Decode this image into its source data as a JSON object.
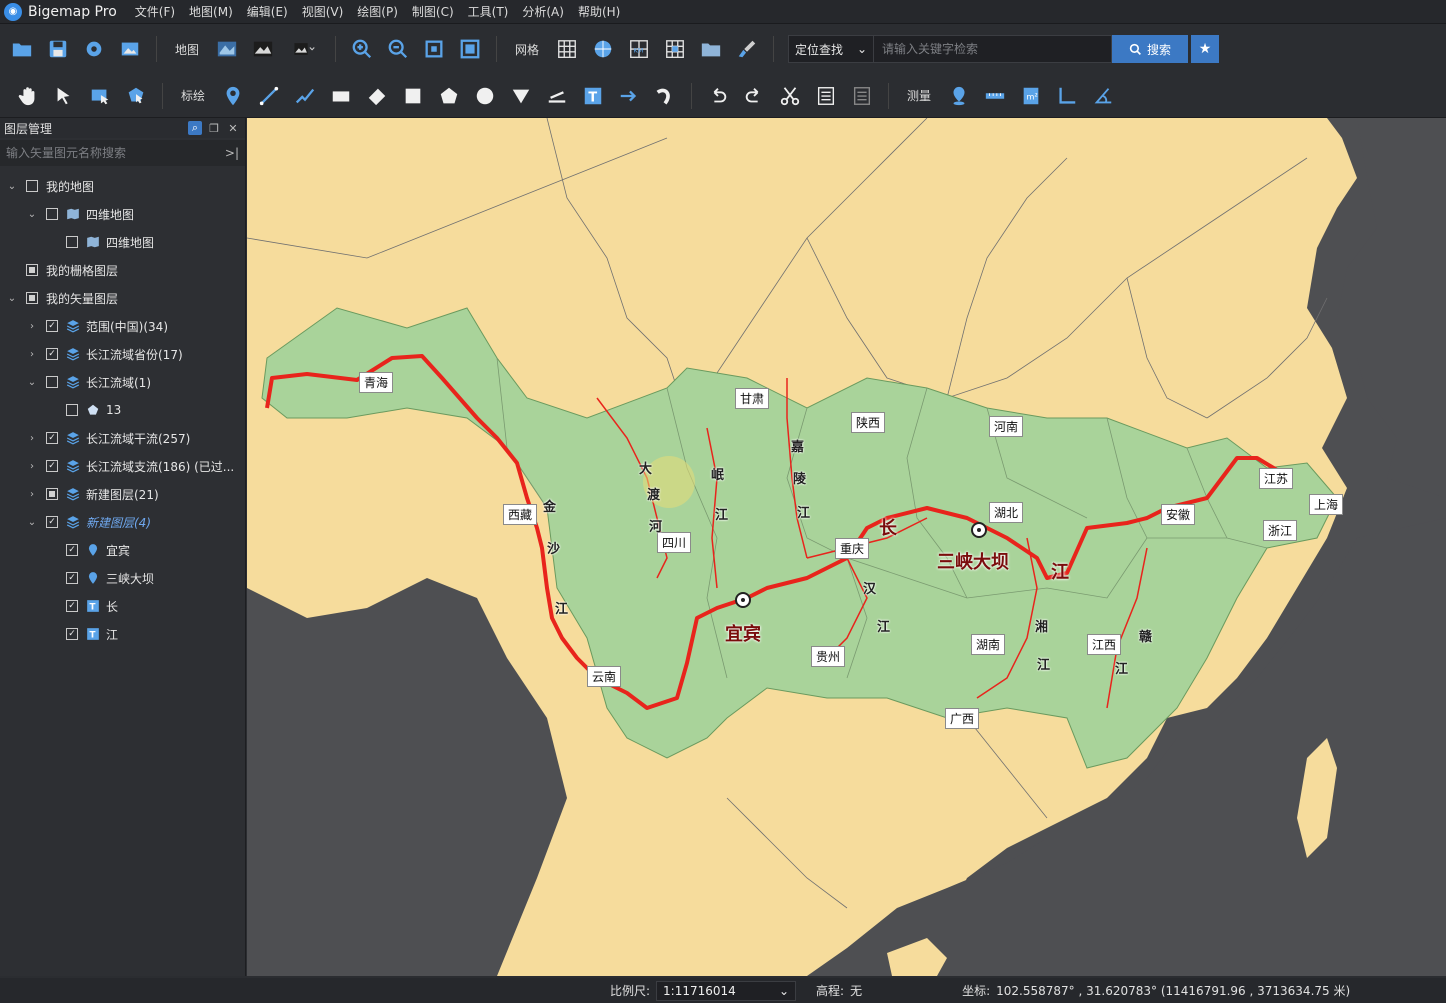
{
  "app": {
    "title": "Bigemap Pro",
    "logo_icon": "globe-logo-icon"
  },
  "menu": [
    "文件(F)",
    "地图(M)",
    "编辑(E)",
    "视图(V)",
    "绘图(P)",
    "制图(C)",
    "工具(T)",
    "分析(A)",
    "帮助(H)"
  ],
  "toolbar1": {
    "map_label": "地图",
    "grid_label": "网格",
    "search_mode": "定位查找",
    "search_placeholder": "请输入关键字检索",
    "search_button": "搜索"
  },
  "toolbar2": {
    "annotate_label": "标绘",
    "measure_label": "测量"
  },
  "sidebar": {
    "title": "图层管理",
    "search_placeholder": "输入矢量图元名称搜索",
    "tree": [
      {
        "label": "我的地图",
        "indent": 0,
        "arrow": "v",
        "check": "none",
        "icon": ""
      },
      {
        "label": "四维地图",
        "indent": 1,
        "arrow": "v",
        "check": "none",
        "icon": "map"
      },
      {
        "label": "四维地图",
        "indent": 2,
        "arrow": "",
        "check": "none",
        "icon": "map"
      },
      {
        "label": "我的栅格图层",
        "indent": 0,
        "arrow": "",
        "check": "partial",
        "icon": ""
      },
      {
        "label": "我的矢量图层",
        "indent": 0,
        "arrow": "v",
        "check": "partial",
        "icon": ""
      },
      {
        "label": "范围(中国)(34)",
        "indent": 1,
        "arrow": ">",
        "check": "checked",
        "icon": "layers"
      },
      {
        "label": "长江流域省份(17)",
        "indent": 1,
        "arrow": ">",
        "check": "checked",
        "icon": "layers"
      },
      {
        "label": "长江流域(1)",
        "indent": 1,
        "arrow": "v",
        "check": "none",
        "icon": "layers"
      },
      {
        "label": "13",
        "indent": 2,
        "arrow": "",
        "check": "none",
        "icon": "polygon"
      },
      {
        "label": "长江流域干流(257)",
        "indent": 1,
        "arrow": ">",
        "check": "checked",
        "icon": "layers"
      },
      {
        "label": "长江流域支流(186) (已过...",
        "indent": 1,
        "arrow": ">",
        "check": "checked",
        "icon": "layers"
      },
      {
        "label": "新建图层(21)",
        "indent": 1,
        "arrow": ">",
        "check": "partial",
        "icon": "layers"
      },
      {
        "label": "新建图层(4)",
        "indent": 1,
        "arrow": "v",
        "check": "checked",
        "icon": "layers",
        "italic": true
      },
      {
        "label": "宜宾",
        "indent": 2,
        "arrow": "",
        "check": "checked",
        "icon": "pin"
      },
      {
        "label": "三峡大坝",
        "indent": 2,
        "arrow": "",
        "check": "checked",
        "icon": "pin"
      },
      {
        "label": "长",
        "indent": 2,
        "arrow": "",
        "check": "checked",
        "icon": "text"
      },
      {
        "label": "江",
        "indent": 2,
        "arrow": "",
        "check": "checked",
        "icon": "text"
      }
    ]
  },
  "map": {
    "colors": {
      "sea": "#4e4f52",
      "land": "#f6dc9c",
      "basin": "#a9d39a",
      "river": "#e8241c",
      "border": "#6f6f6f"
    },
    "province_labels": [
      "青海",
      "西藏",
      "甘肃",
      "陕西",
      "河南",
      "四川",
      "重庆",
      "湖北",
      "安徽",
      "江苏",
      "上海",
      "浙江",
      "湖南",
      "江西",
      "贵州",
      "云南",
      "广西"
    ],
    "river_chars": [
      "金",
      "沙",
      "江",
      "大",
      "渡",
      "河",
      "岷",
      "江",
      "嘉",
      "陵",
      "江",
      "汉",
      "江",
      "湘",
      "江",
      "赣",
      "江"
    ],
    "big_labels": [
      "长",
      "江",
      "宜宾",
      "三峡大坝"
    ]
  },
  "status": {
    "scale_label": "比例尺:",
    "scale_value": "1:11716014",
    "elevation_label": "高程:",
    "elevation_value": "无",
    "coord_label": "坐标:",
    "coord_value": "102.558787° , 31.620783°  (11416791.96 , 3713634.75 米)"
  }
}
